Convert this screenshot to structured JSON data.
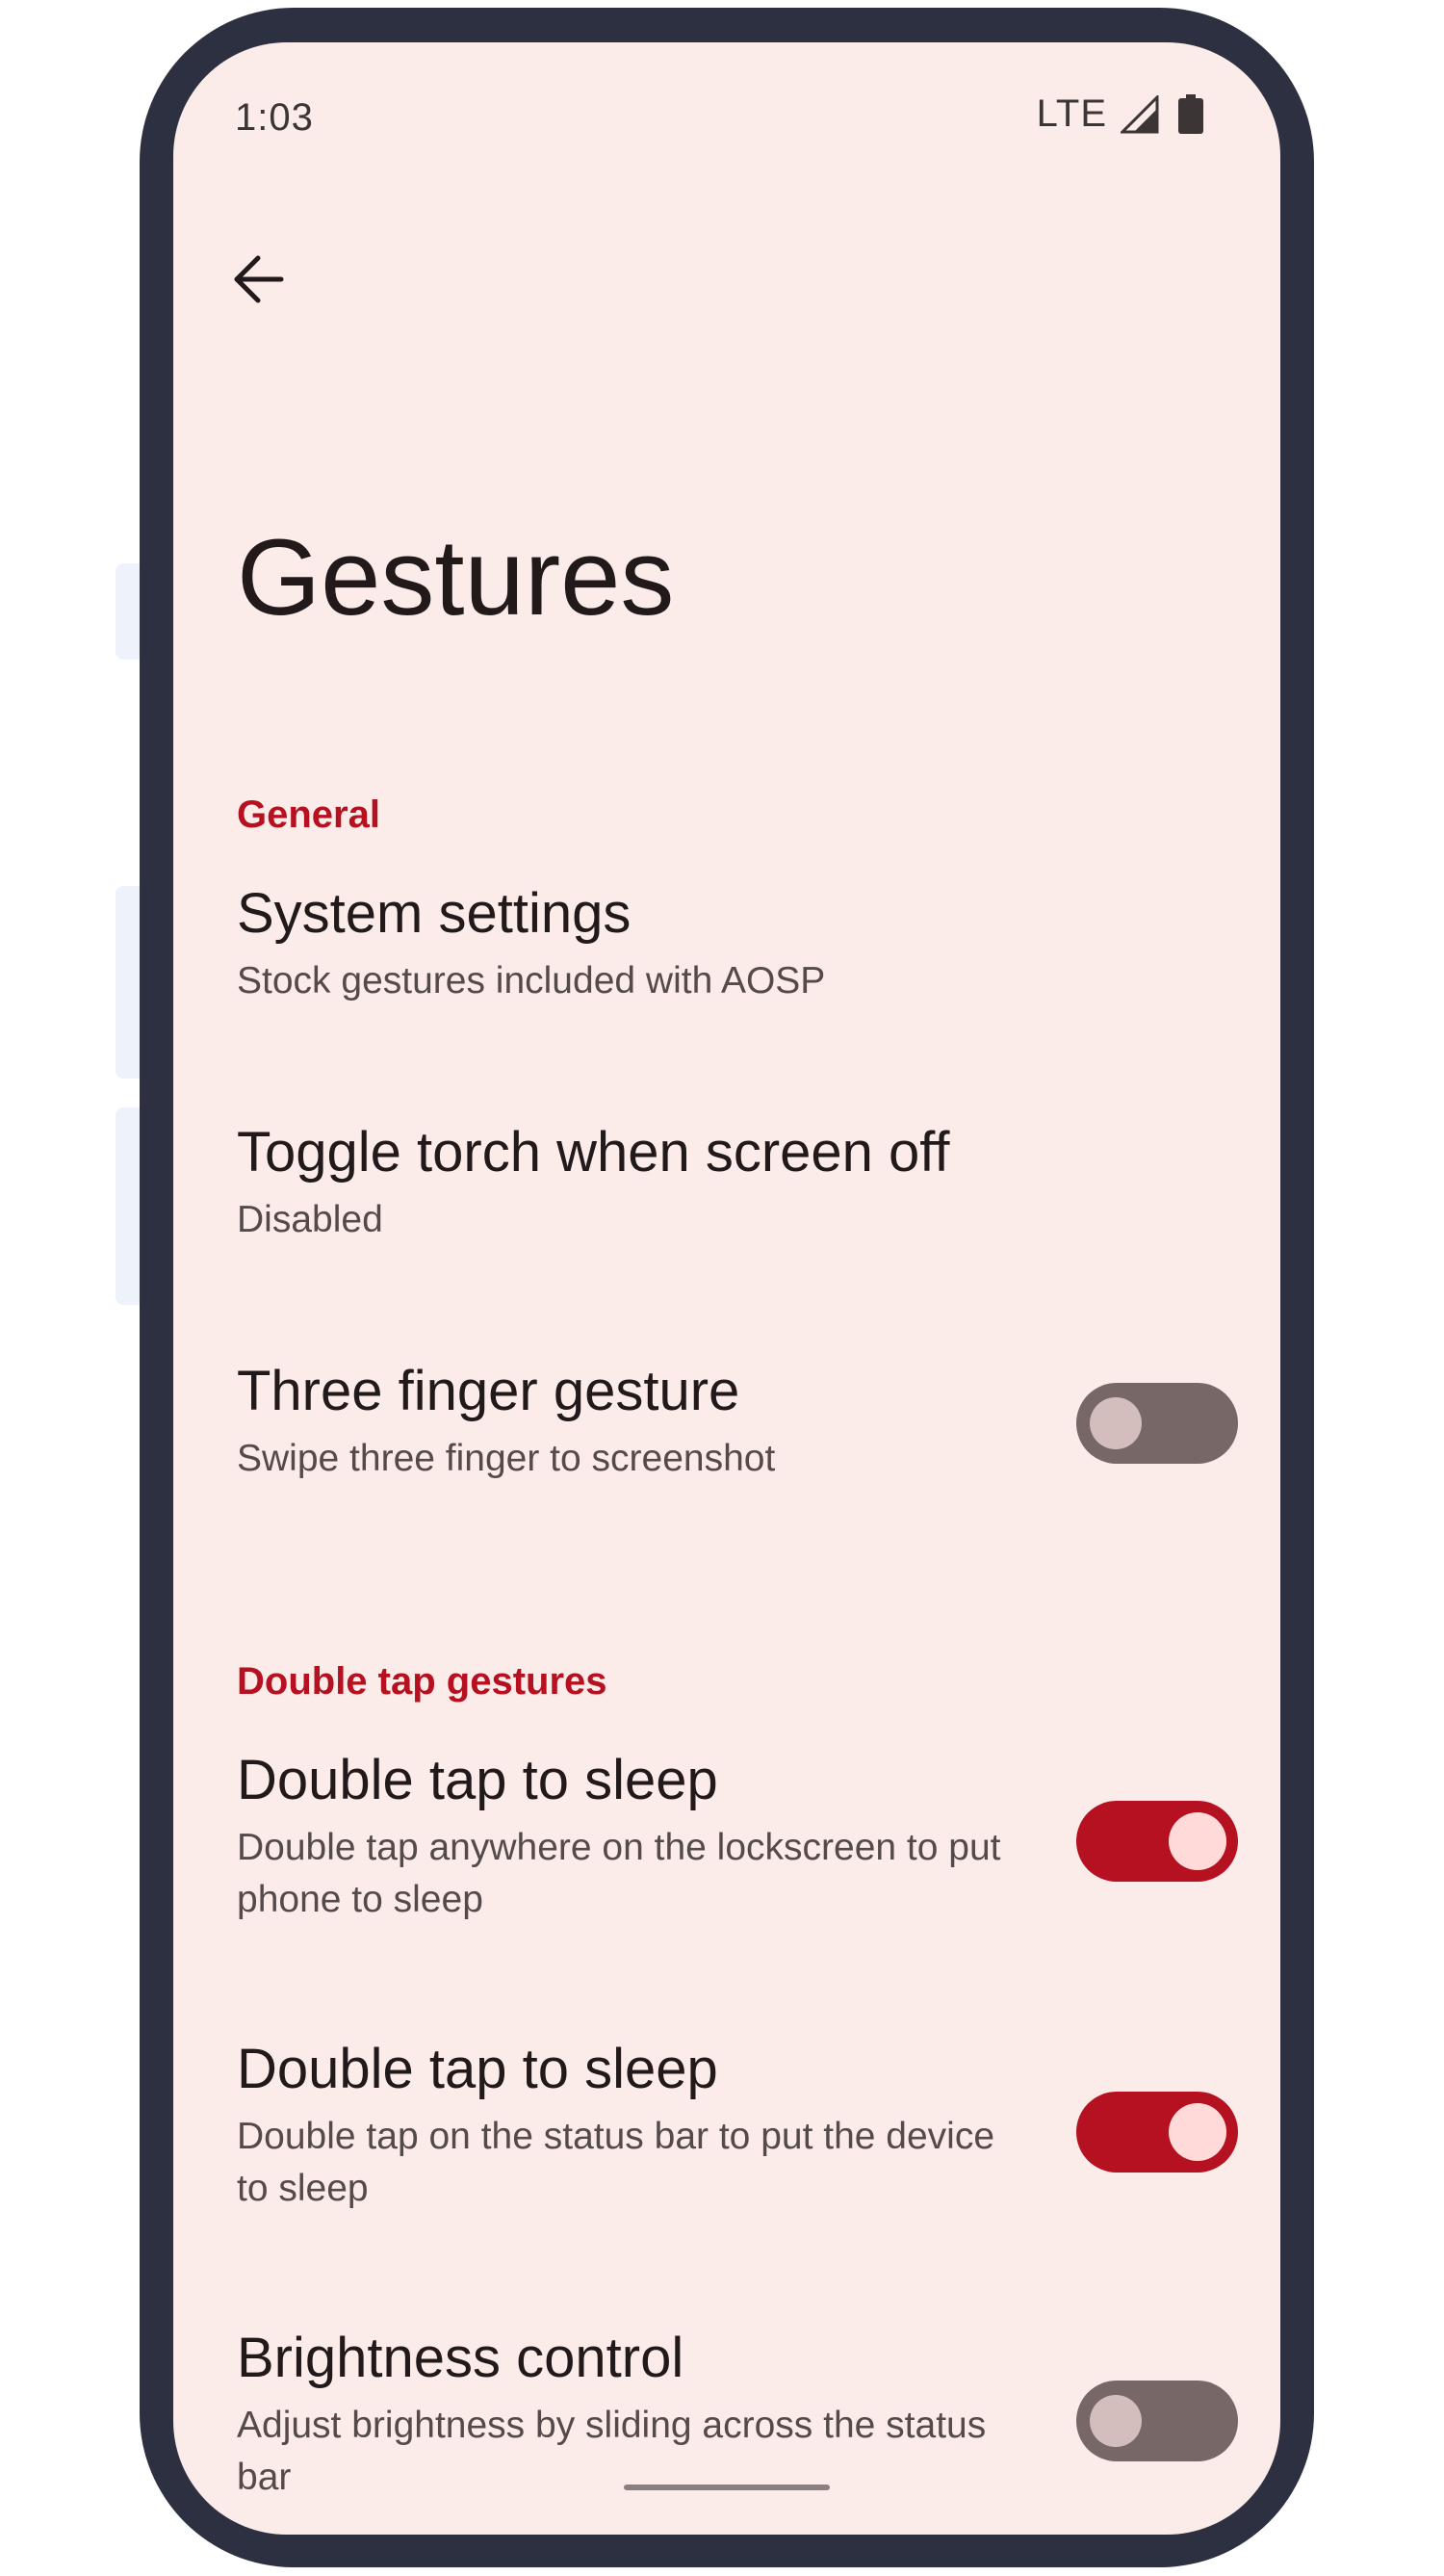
{
  "status_bar": {
    "time": "1:03",
    "network": "LTE",
    "icons": [
      "signal-icon",
      "battery-icon"
    ]
  },
  "toolbar": {
    "back_icon": "arrow-back-icon"
  },
  "page": {
    "title": "Gestures"
  },
  "sections": {
    "general": {
      "header": "General",
      "items": [
        {
          "title": "System settings",
          "summary": "Stock gestures included with AOSP"
        },
        {
          "title": "Toggle torch when screen off",
          "summary": "Disabled"
        },
        {
          "title": "Three finger gesture",
          "summary": "Swipe three finger to screenshot",
          "toggle": false
        }
      ]
    },
    "double_tap": {
      "header": "Double tap gestures",
      "items": [
        {
          "title": "Double tap to sleep",
          "summary": "Double tap anywhere on the lockscreen to put phone to sleep",
          "toggle": true
        },
        {
          "title": "Double tap to sleep",
          "summary": "Double tap on the status bar to put the device to sleep",
          "toggle": true
        },
        {
          "title": "Brightness control",
          "summary": "Adjust brightness by sliding across the status bar",
          "toggle": false
        }
      ]
    }
  },
  "colors": {
    "accent": "#b51120",
    "screen_background": "#fbecea",
    "frame": "#2d3040",
    "toggle_off_track": "#776767",
    "toggle_on_thumb": "#ffdad8"
  }
}
